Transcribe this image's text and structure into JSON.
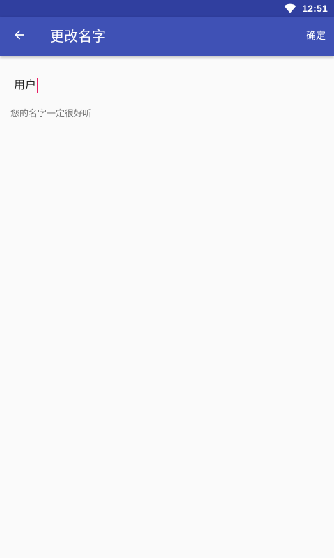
{
  "status_bar": {
    "time": "12:51",
    "icons": [
      "wifi-icon"
    ]
  },
  "toolbar": {
    "back_icon": "arrow-left-icon",
    "title": "更改名字",
    "confirm_label": "确定"
  },
  "form": {
    "name_value": "用户",
    "helper_text": "您的名字一定很好听"
  },
  "colors": {
    "status_bar": "#303f9f",
    "toolbar": "#3f51b5",
    "background": "#fafafa",
    "field_underline": "#9ccc9c",
    "caret": "#e91e63"
  }
}
